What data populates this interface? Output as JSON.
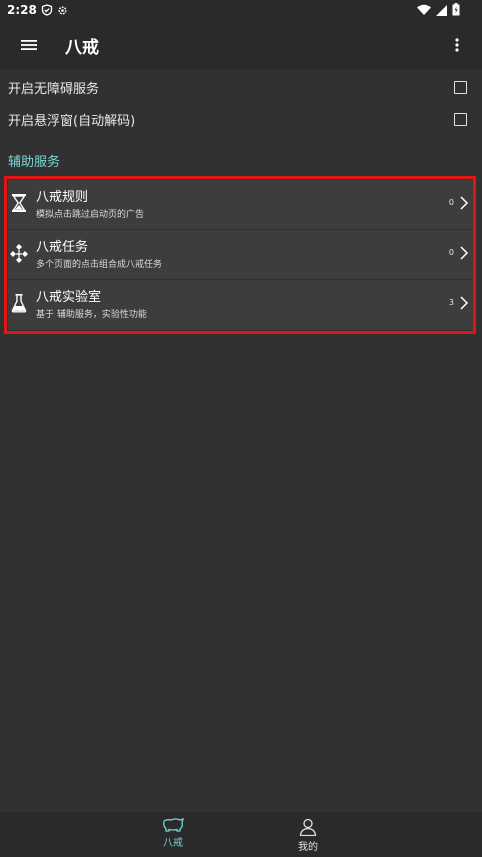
{
  "status_bar": {
    "time": "2:28"
  },
  "app_bar": {
    "title": "八戒"
  },
  "settings": [
    {
      "label": "开启无障碍服务",
      "checked": false
    },
    {
      "label": "开启悬浮窗(自动解码)",
      "checked": false
    }
  ],
  "section": {
    "title": "辅助服务"
  },
  "items": [
    {
      "icon": "hourglass-icon",
      "name": "八戒规则",
      "desc": "模拟点击跳过启动页的广告",
      "count": "0"
    },
    {
      "icon": "workflow-icon",
      "name": "八戒任务",
      "desc": "多个页面的点击组合成八戒任务",
      "count": "0"
    },
    {
      "icon": "flask-icon",
      "name": "八戒实验室",
      "desc": "基于 辅助服务，实验性功能",
      "count": "3"
    }
  ],
  "bottom_nav": [
    {
      "label": "八戒",
      "icon": "pig-icon",
      "active": true
    },
    {
      "label": "我的",
      "icon": "person-icon",
      "active": false
    }
  ],
  "colors": {
    "accent": "#7ad6d2",
    "highlight": "#e01515",
    "background": "#313131"
  }
}
